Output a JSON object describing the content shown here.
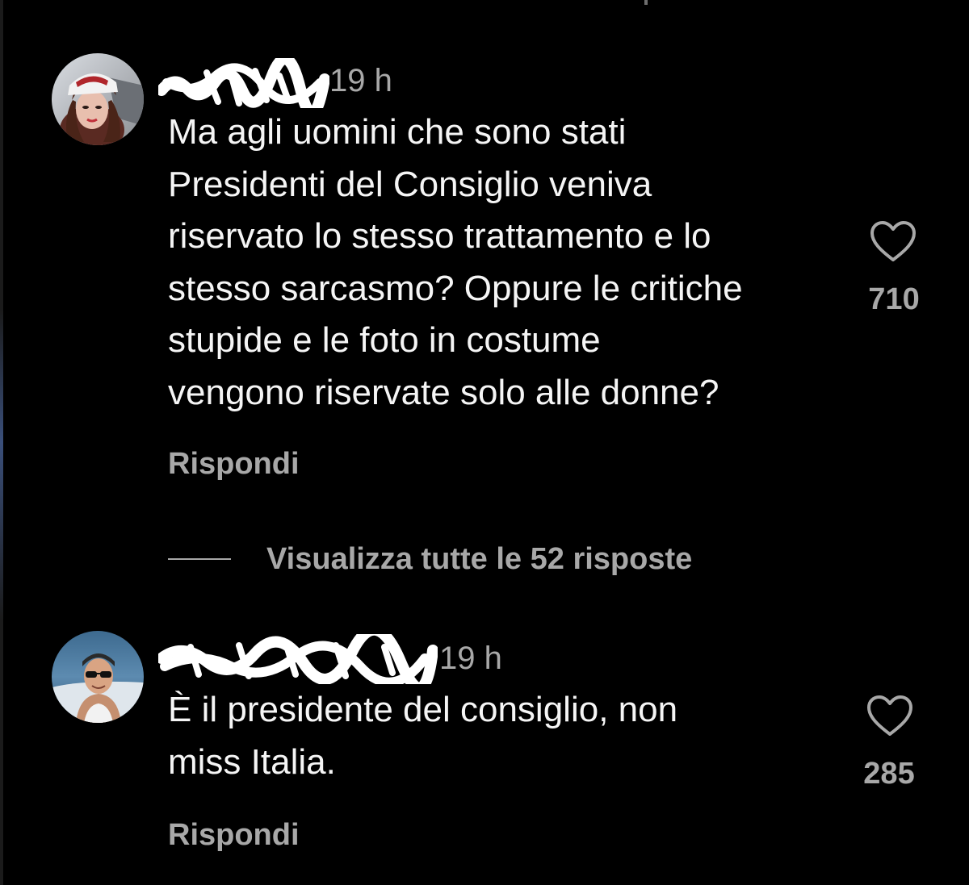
{
  "comments": [
    {
      "time": "19 h",
      "text_lines": [
        "Ma agli uomini che sono stati",
        "Presidenti del Consiglio veniva",
        "riservato lo stesso trattamento e lo",
        "stesso sarcasmo? Oppure le critiche",
        "stupide e le foto in costume",
        "vengono riservate solo alle donne?"
      ],
      "likes": "710",
      "reply_label": "Rispondi",
      "like_icon": "heart-outline-icon"
    },
    {
      "time": "19 h",
      "text_lines": [
        "È il presidente del consiglio, non",
        "miss Italia."
      ],
      "likes": "285",
      "reply_label": "Rispondi",
      "like_icon": "heart-outline-icon"
    }
  ],
  "view_replies": {
    "label": "Visualizza tutte le 52 risposte"
  },
  "colors": {
    "background": "#000000",
    "primary_text": "#f5f5f5",
    "secondary_text": "#a8a8a8"
  }
}
